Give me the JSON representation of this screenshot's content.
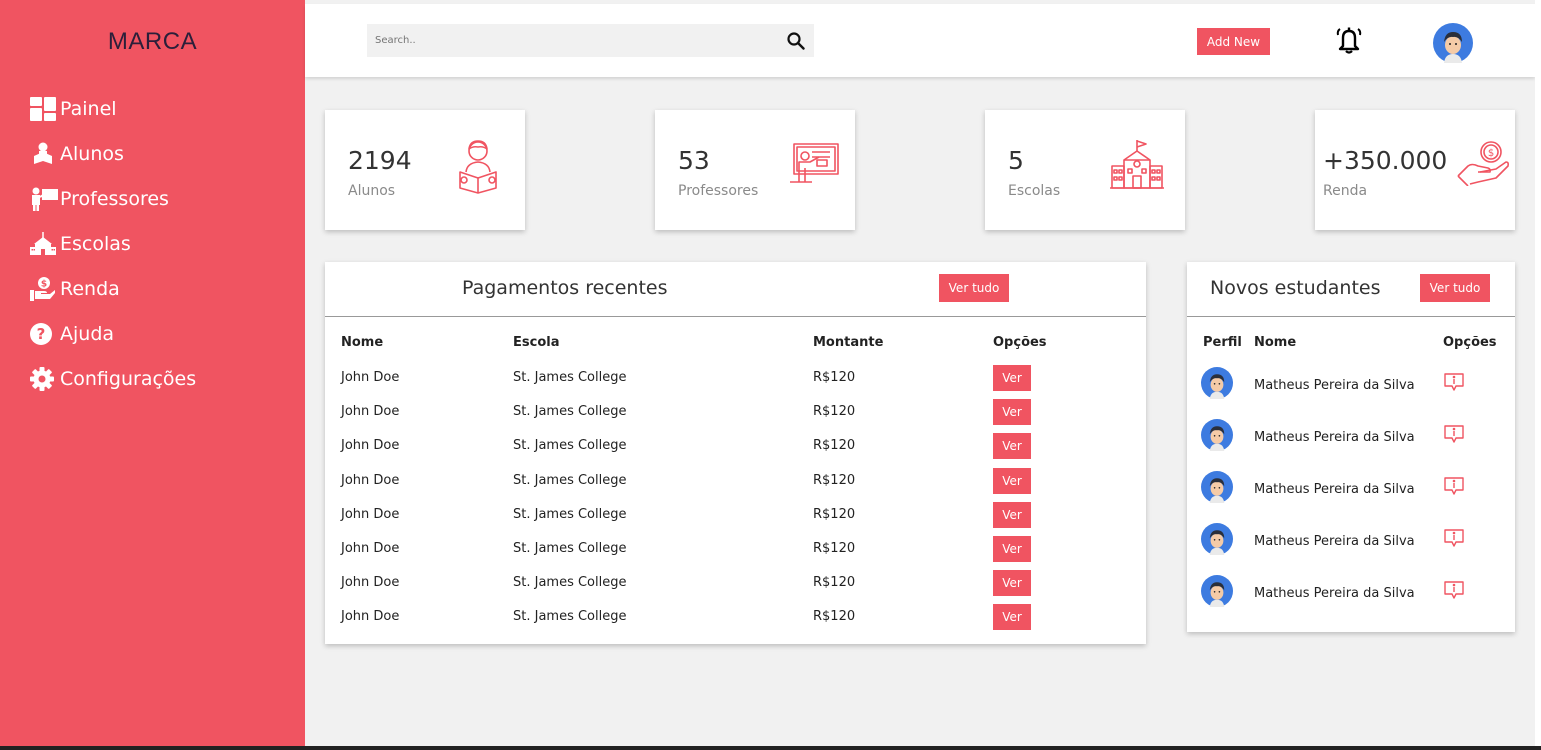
{
  "sidebar": {
    "brand": "MARCA",
    "items": [
      {
        "label": "Painel",
        "icon": "dashboard-icon"
      },
      {
        "label": "Alunos",
        "icon": "student-icon"
      },
      {
        "label": "Professores",
        "icon": "teacher-icon"
      },
      {
        "label": "Escolas",
        "icon": "school-icon"
      },
      {
        "label": "Renda",
        "icon": "income-icon"
      },
      {
        "label": "Ajuda",
        "icon": "help-icon"
      },
      {
        "label": "Configurações",
        "icon": "gear-icon"
      }
    ]
  },
  "header": {
    "search_placeholder": "Search..",
    "add_new_label": "Add New"
  },
  "stats": [
    {
      "value": "2194",
      "label": "Alunos",
      "icon": "student-reading-icon"
    },
    {
      "value": "53",
      "label": "Professores",
      "icon": "teacher-board-icon"
    },
    {
      "value": "5",
      "label": "Escolas",
      "icon": "school-building-icon"
    },
    {
      "value": "+350.000",
      "label": "Renda",
      "icon": "money-hand-icon"
    }
  ],
  "payments": {
    "title": "Pagamentos recentes",
    "view_all": "Ver tudo",
    "columns": [
      "Nome",
      "Escola",
      "Montante",
      "Opções"
    ],
    "rows": [
      {
        "name": "John Doe",
        "school": "St. James College",
        "amount": "R$120",
        "action": "Ver"
      },
      {
        "name": "John Doe",
        "school": "St. James College",
        "amount": "R$120",
        "action": "Ver"
      },
      {
        "name": "John Doe",
        "school": "St. James College",
        "amount": "R$120",
        "action": "Ver"
      },
      {
        "name": "John Doe",
        "school": "St. James College",
        "amount": "R$120",
        "action": "Ver"
      },
      {
        "name": "John Doe",
        "school": "St. James College",
        "amount": "R$120",
        "action": "Ver"
      },
      {
        "name": "John Doe",
        "school": "St. James College",
        "amount": "R$120",
        "action": "Ver"
      },
      {
        "name": "John Doe",
        "school": "St. James College",
        "amount": "R$120",
        "action": "Ver"
      },
      {
        "name": "John Doe",
        "school": "St. James College",
        "amount": "R$120",
        "action": "Ver"
      }
    ]
  },
  "new_students": {
    "title": "Novos estudantes",
    "view_all": "Ver tudo",
    "columns": [
      "Perfil",
      "Nome",
      "Opções"
    ],
    "rows": [
      {
        "name": "Matheus Pereira da Silva"
      },
      {
        "name": "Matheus Pereira da Silva"
      },
      {
        "name": "Matheus Pereira da Silva"
      },
      {
        "name": "Matheus Pereira da Silva"
      },
      {
        "name": "Matheus Pereira da Silva"
      }
    ]
  },
  "colors": {
    "accent": "#f05461",
    "brand_text": "#2b1f3a",
    "avatar_blue": "#3d7be0"
  }
}
